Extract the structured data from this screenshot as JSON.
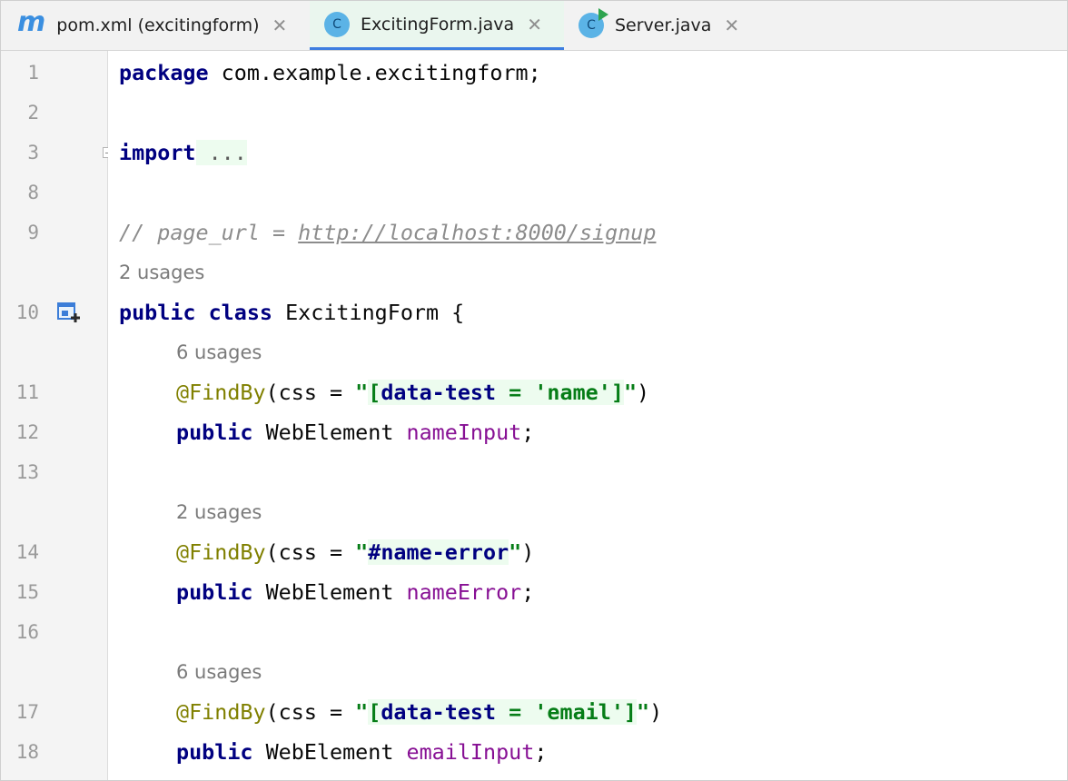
{
  "tabs": [
    {
      "label": "pom.xml (excitingform)",
      "icon": "maven-m-icon",
      "icon_text": "m",
      "active": false
    },
    {
      "label": "ExcitingForm.java",
      "icon": "java-class-icon",
      "icon_text": "C",
      "active": true
    },
    {
      "label": "Server.java",
      "icon": "java-run-class-icon",
      "icon_text": "C",
      "active": false
    }
  ],
  "close_glyph": "✕",
  "gutter": {
    "line_numbers": [
      "1",
      "2",
      "3",
      "8",
      "9",
      "10",
      "11",
      "12",
      "13",
      "14",
      "15",
      "16",
      "17",
      "18"
    ]
  },
  "code": {
    "l1": {
      "kw": "package",
      "rest": " com.example.excitingform;"
    },
    "l3": {
      "kw": "import",
      "folded": " ..."
    },
    "l9": {
      "comment": "// page_url = ",
      "url": "http://localhost:8000/signup"
    },
    "h_class": "2 usages",
    "l10": {
      "kw1": "public",
      "kw2": "class",
      "rest": " ExcitingForm {"
    },
    "h11": "6 usages",
    "l11": {
      "ann": "@FindBy",
      "mid": "(css = ",
      "q1": "\"",
      "s1": "[",
      "s2": "data-test",
      "s3": " = ",
      "s4": "'name'",
      "s5": "]",
      "q2": "\"",
      "end": ")"
    },
    "l12": {
      "kw": "public",
      "type": " WebElement ",
      "field": "nameInput",
      "end": ";"
    },
    "h14": "2 usages",
    "l14": {
      "ann": "@FindBy",
      "mid": "(css = ",
      "q1": "\"",
      "s1": "#name-error",
      "q2": "\"",
      "end": ")"
    },
    "l15": {
      "kw": "public",
      "type": " WebElement ",
      "field": "nameError",
      "end": ";"
    },
    "h17": "6 usages",
    "l17": {
      "ann": "@FindBy",
      "mid": "(css = ",
      "q1": "\"",
      "s1": "[",
      "s2": "data-test",
      "s3": " = ",
      "s4": "'email'",
      "s5": "]",
      "q2": "\"",
      "end": ")"
    },
    "l18": {
      "kw": "public",
      "type": " WebElement ",
      "field": "emailInput",
      "end": ";"
    }
  },
  "colors": {
    "keyword": "#000080",
    "annotation": "#808000",
    "field": "#871094",
    "string": "#067d17",
    "highlight": "#edfcef",
    "active_tab_border": "#3d7ee0"
  }
}
